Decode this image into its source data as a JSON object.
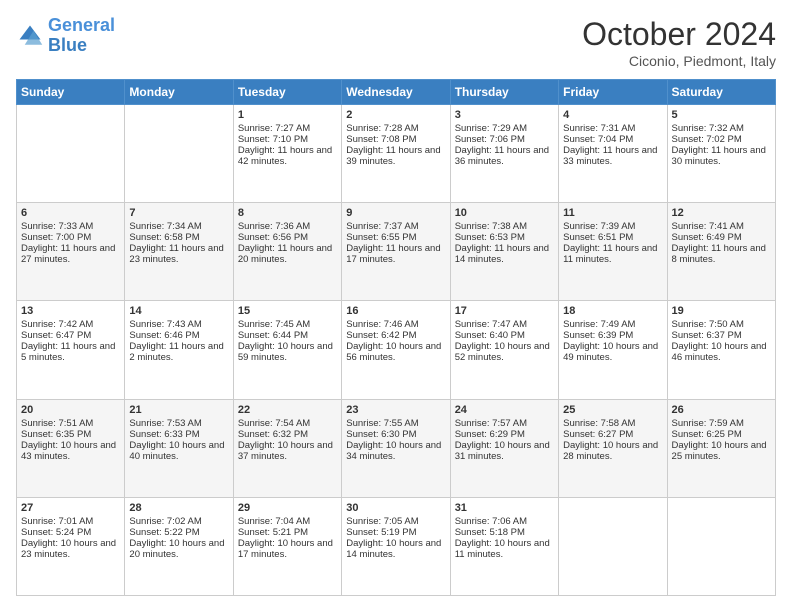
{
  "logo": {
    "line1": "General",
    "line2": "Blue"
  },
  "title": "October 2024",
  "location": "Ciconio, Piedmont, Italy",
  "days_of_week": [
    "Sunday",
    "Monday",
    "Tuesday",
    "Wednesday",
    "Thursday",
    "Friday",
    "Saturday"
  ],
  "weeks": [
    [
      {
        "day": "",
        "content": ""
      },
      {
        "day": "",
        "content": ""
      },
      {
        "day": "1",
        "sunrise": "Sunrise: 7:27 AM",
        "sunset": "Sunset: 7:10 PM",
        "daylight": "Daylight: 11 hours and 42 minutes."
      },
      {
        "day": "2",
        "sunrise": "Sunrise: 7:28 AM",
        "sunset": "Sunset: 7:08 PM",
        "daylight": "Daylight: 11 hours and 39 minutes."
      },
      {
        "day": "3",
        "sunrise": "Sunrise: 7:29 AM",
        "sunset": "Sunset: 7:06 PM",
        "daylight": "Daylight: 11 hours and 36 minutes."
      },
      {
        "day": "4",
        "sunrise": "Sunrise: 7:31 AM",
        "sunset": "Sunset: 7:04 PM",
        "daylight": "Daylight: 11 hours and 33 minutes."
      },
      {
        "day": "5",
        "sunrise": "Sunrise: 7:32 AM",
        "sunset": "Sunset: 7:02 PM",
        "daylight": "Daylight: 11 hours and 30 minutes."
      }
    ],
    [
      {
        "day": "6",
        "sunrise": "Sunrise: 7:33 AM",
        "sunset": "Sunset: 7:00 PM",
        "daylight": "Daylight: 11 hours and 27 minutes."
      },
      {
        "day": "7",
        "sunrise": "Sunrise: 7:34 AM",
        "sunset": "Sunset: 6:58 PM",
        "daylight": "Daylight: 11 hours and 23 minutes."
      },
      {
        "day": "8",
        "sunrise": "Sunrise: 7:36 AM",
        "sunset": "Sunset: 6:56 PM",
        "daylight": "Daylight: 11 hours and 20 minutes."
      },
      {
        "day": "9",
        "sunrise": "Sunrise: 7:37 AM",
        "sunset": "Sunset: 6:55 PM",
        "daylight": "Daylight: 11 hours and 17 minutes."
      },
      {
        "day": "10",
        "sunrise": "Sunrise: 7:38 AM",
        "sunset": "Sunset: 6:53 PM",
        "daylight": "Daylight: 11 hours and 14 minutes."
      },
      {
        "day": "11",
        "sunrise": "Sunrise: 7:39 AM",
        "sunset": "Sunset: 6:51 PM",
        "daylight": "Daylight: 11 hours and 11 minutes."
      },
      {
        "day": "12",
        "sunrise": "Sunrise: 7:41 AM",
        "sunset": "Sunset: 6:49 PM",
        "daylight": "Daylight: 11 hours and 8 minutes."
      }
    ],
    [
      {
        "day": "13",
        "sunrise": "Sunrise: 7:42 AM",
        "sunset": "Sunset: 6:47 PM",
        "daylight": "Daylight: 11 hours and 5 minutes."
      },
      {
        "day": "14",
        "sunrise": "Sunrise: 7:43 AM",
        "sunset": "Sunset: 6:46 PM",
        "daylight": "Daylight: 11 hours and 2 minutes."
      },
      {
        "day": "15",
        "sunrise": "Sunrise: 7:45 AM",
        "sunset": "Sunset: 6:44 PM",
        "daylight": "Daylight: 10 hours and 59 minutes."
      },
      {
        "day": "16",
        "sunrise": "Sunrise: 7:46 AM",
        "sunset": "Sunset: 6:42 PM",
        "daylight": "Daylight: 10 hours and 56 minutes."
      },
      {
        "day": "17",
        "sunrise": "Sunrise: 7:47 AM",
        "sunset": "Sunset: 6:40 PM",
        "daylight": "Daylight: 10 hours and 52 minutes."
      },
      {
        "day": "18",
        "sunrise": "Sunrise: 7:49 AM",
        "sunset": "Sunset: 6:39 PM",
        "daylight": "Daylight: 10 hours and 49 minutes."
      },
      {
        "day": "19",
        "sunrise": "Sunrise: 7:50 AM",
        "sunset": "Sunset: 6:37 PM",
        "daylight": "Daylight: 10 hours and 46 minutes."
      }
    ],
    [
      {
        "day": "20",
        "sunrise": "Sunrise: 7:51 AM",
        "sunset": "Sunset: 6:35 PM",
        "daylight": "Daylight: 10 hours and 43 minutes."
      },
      {
        "day": "21",
        "sunrise": "Sunrise: 7:53 AM",
        "sunset": "Sunset: 6:33 PM",
        "daylight": "Daylight: 10 hours and 40 minutes."
      },
      {
        "day": "22",
        "sunrise": "Sunrise: 7:54 AM",
        "sunset": "Sunset: 6:32 PM",
        "daylight": "Daylight: 10 hours and 37 minutes."
      },
      {
        "day": "23",
        "sunrise": "Sunrise: 7:55 AM",
        "sunset": "Sunset: 6:30 PM",
        "daylight": "Daylight: 10 hours and 34 minutes."
      },
      {
        "day": "24",
        "sunrise": "Sunrise: 7:57 AM",
        "sunset": "Sunset: 6:29 PM",
        "daylight": "Daylight: 10 hours and 31 minutes."
      },
      {
        "day": "25",
        "sunrise": "Sunrise: 7:58 AM",
        "sunset": "Sunset: 6:27 PM",
        "daylight": "Daylight: 10 hours and 28 minutes."
      },
      {
        "day": "26",
        "sunrise": "Sunrise: 7:59 AM",
        "sunset": "Sunset: 6:25 PM",
        "daylight": "Daylight: 10 hours and 25 minutes."
      }
    ],
    [
      {
        "day": "27",
        "sunrise": "Sunrise: 7:01 AM",
        "sunset": "Sunset: 5:24 PM",
        "daylight": "Daylight: 10 hours and 23 minutes."
      },
      {
        "day": "28",
        "sunrise": "Sunrise: 7:02 AM",
        "sunset": "Sunset: 5:22 PM",
        "daylight": "Daylight: 10 hours and 20 minutes."
      },
      {
        "day": "29",
        "sunrise": "Sunrise: 7:04 AM",
        "sunset": "Sunset: 5:21 PM",
        "daylight": "Daylight: 10 hours and 17 minutes."
      },
      {
        "day": "30",
        "sunrise": "Sunrise: 7:05 AM",
        "sunset": "Sunset: 5:19 PM",
        "daylight": "Daylight: 10 hours and 14 minutes."
      },
      {
        "day": "31",
        "sunrise": "Sunrise: 7:06 AM",
        "sunset": "Sunset: 5:18 PM",
        "daylight": "Daylight: 10 hours and 11 minutes."
      },
      {
        "day": "",
        "content": ""
      },
      {
        "day": "",
        "content": ""
      }
    ]
  ]
}
